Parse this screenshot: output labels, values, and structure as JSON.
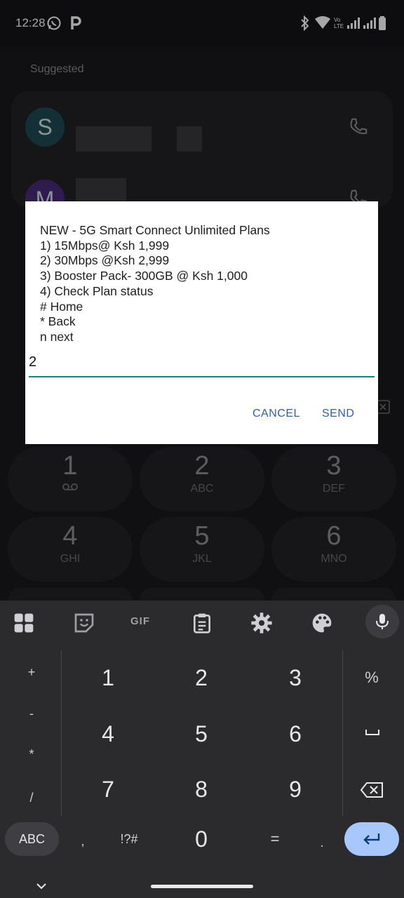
{
  "status_bar": {
    "time": "12:28",
    "left_icons": [
      "whatsapp-icon",
      "p-app-icon"
    ],
    "right_icons": [
      "bluetooth-icon",
      "wifi-icon",
      "volte-icon",
      "signal-icon",
      "signal-icon",
      "battery-icon"
    ],
    "volte_label": "Vo LTE"
  },
  "dialer": {
    "suggested_label": "Suggested",
    "contacts": [
      {
        "initial": "S",
        "color": "#1f4a55"
      },
      {
        "initial": "M",
        "color": "#4b2a7a"
      }
    ],
    "keypad": [
      {
        "num": "1",
        "letters": "voicemail"
      },
      {
        "num": "2",
        "letters": "ABC"
      },
      {
        "num": "3",
        "letters": "DEF"
      },
      {
        "num": "4",
        "letters": "GHI"
      },
      {
        "num": "5",
        "letters": "JKL"
      },
      {
        "num": "6",
        "letters": "MNO"
      }
    ]
  },
  "dialog": {
    "message": "NEW - 5G Smart Connect Unlimited Plans\n1) 15Mbps@ Ksh 1,999\n2) 30Mbps @Ksh 2,999\n3) Booster Pack- 300GB @ Ksh 1,000\n4) Check Plan status\n# Home\n* Back\nn next",
    "input_value": "2",
    "cancel_label": "CANCEL",
    "send_label": "SEND",
    "accent": "#0e8b7c"
  },
  "keyboard": {
    "toolbar": [
      "apps-grid-icon",
      "sticker-icon",
      "gif-icon",
      "clipboard-icon",
      "settings-gear-icon",
      "palette-icon",
      "mic-icon"
    ],
    "gif_label": "GIF",
    "side_symbols": [
      "+",
      "-",
      "*",
      "/"
    ],
    "digits": [
      "1",
      "2",
      "3",
      "4",
      "5",
      "6",
      "7",
      "8",
      "9"
    ],
    "right_keys": [
      "%",
      "space",
      "backspace"
    ],
    "bottom": {
      "abc_label": "ABC",
      "comma": ",",
      "symbols_label": "!?#",
      "zero": "0",
      "equals": "=",
      "period": ".",
      "enter": "enter-icon"
    }
  }
}
